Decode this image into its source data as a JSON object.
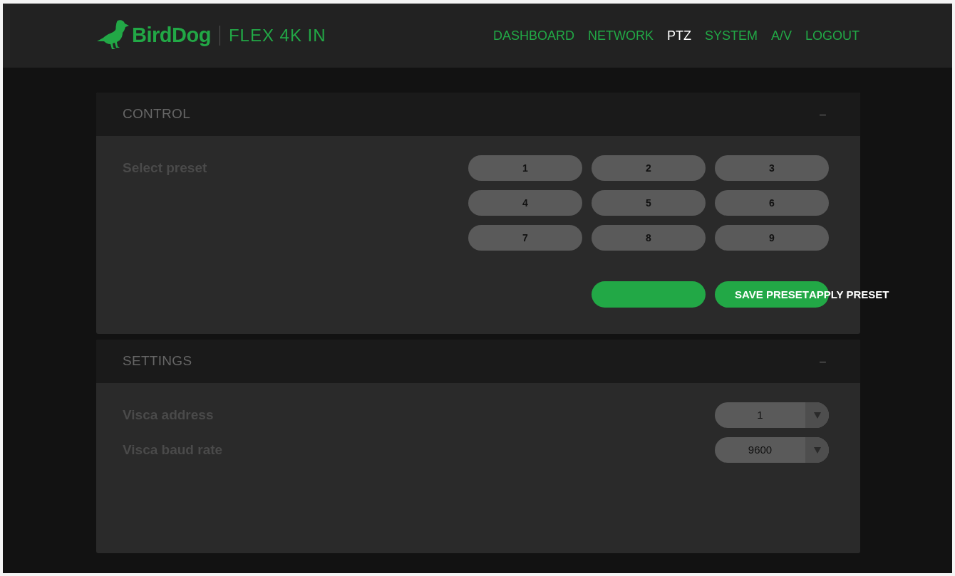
{
  "header": {
    "logo": {
      "brand": "BirdDog",
      "product": "FLEX 4K IN"
    },
    "nav": [
      {
        "label": "DASHBOARD",
        "selected": false
      },
      {
        "label": "NETWORK",
        "selected": false
      },
      {
        "label": "PTZ",
        "selected": true
      },
      {
        "label": "SYSTEM",
        "selected": false
      },
      {
        "label": "A/V",
        "selected": false
      },
      {
        "label": "LOGOUT",
        "selected": false
      }
    ]
  },
  "control": {
    "title": "CONTROL",
    "collapse": "–",
    "select_preset": {
      "label": "Select preset",
      "presets": [
        "1",
        "2",
        "3",
        "4",
        "5",
        "6",
        "7",
        "8",
        "9"
      ]
    },
    "action_buttons": [
      {
        "kind": "blank"
      },
      {
        "kind": "blank"
      }
    ],
    "overflow_labels": [
      "SAVE PRESET",
      "APPLY PRESET"
    ]
  },
  "settings": {
    "title": "SETTINGS",
    "collapse": "–",
    "fields": [
      {
        "label": "Visca address",
        "value": "1"
      },
      {
        "label": "Visca baud rate",
        "value": "9600"
      }
    ]
  }
}
